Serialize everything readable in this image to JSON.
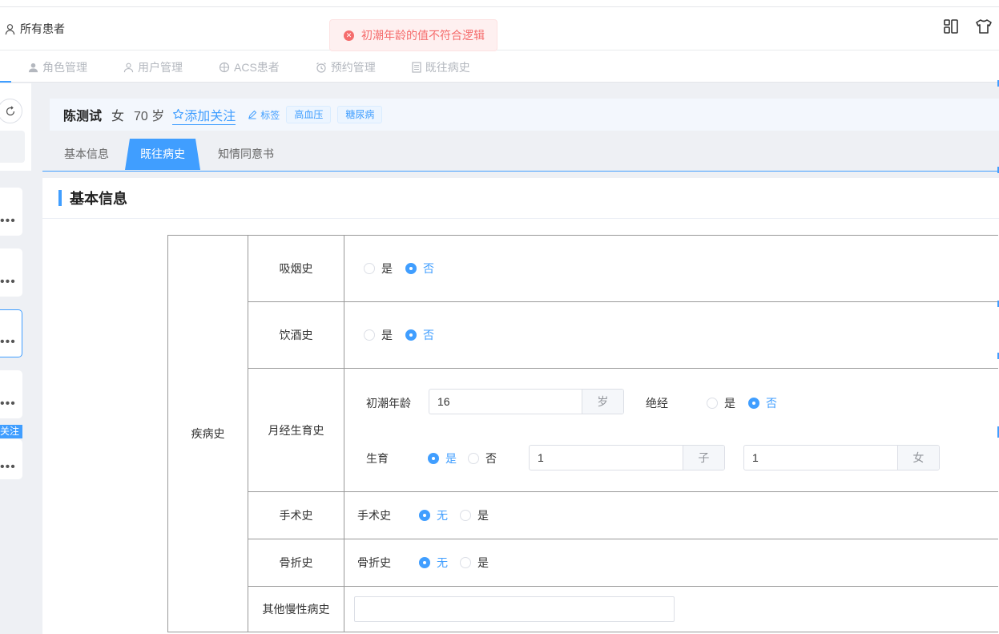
{
  "header": {
    "user_label": "所有患者"
  },
  "toast": {
    "message": "初潮年龄的值不符合逻辑",
    "color": "#f56c6c"
  },
  "nav": [
    {
      "label": "角色管理",
      "icon": "user-icon"
    },
    {
      "label": "用户管理",
      "icon": "user-outline-icon"
    },
    {
      "label": "ACS患者",
      "icon": "crosshair-icon"
    },
    {
      "label": "预约管理",
      "icon": "alarm-icon"
    },
    {
      "label": "既往病史",
      "icon": "document-icon"
    }
  ],
  "sidebar": {
    "follow_tag": "关注",
    "more": "•••"
  },
  "patient": {
    "name": "陈测试",
    "sex": "女",
    "age": "70 岁",
    "follow": "添加关注",
    "label_link": "标签",
    "tags": [
      "高血压",
      "糖尿病"
    ]
  },
  "tabs": [
    "基本信息",
    "既往病史",
    "知情同意书"
  ],
  "active_tab": 1,
  "section": {
    "title": "基本信息"
  },
  "history": {
    "category": "疾病史",
    "smoking": {
      "label": "吸烟史",
      "yes": "是",
      "no": "否",
      "selected": "否"
    },
    "drinking": {
      "label": "饮酒史",
      "yes": "是",
      "no": "否",
      "selected": "否"
    },
    "menstrual": {
      "label": "月经生育史",
      "menarche_label": "初潮年龄",
      "menarche_value": "16",
      "menarche_unit": "岁",
      "menopause_label": "绝经",
      "menopause_yes": "是",
      "menopause_no": "否",
      "menopause_selected": "否",
      "birth_label": "生育",
      "birth_yes": "是",
      "birth_no": "否",
      "birth_selected": "是",
      "sons_value": "1",
      "sons_unit": "子",
      "daughters_value": "1",
      "daughters_unit": "女"
    },
    "surgery": {
      "label": "手术史",
      "inner_label": "手术史",
      "none": "无",
      "yes": "是",
      "selected": "无"
    },
    "fracture": {
      "label": "骨折史",
      "inner_label": "骨折史",
      "none": "无",
      "yes": "是",
      "selected": "无"
    },
    "chronic": {
      "label": "其他慢性病史",
      "value": ""
    }
  },
  "colors": {
    "accent": "#409eff",
    "error": "#f56c6c"
  }
}
